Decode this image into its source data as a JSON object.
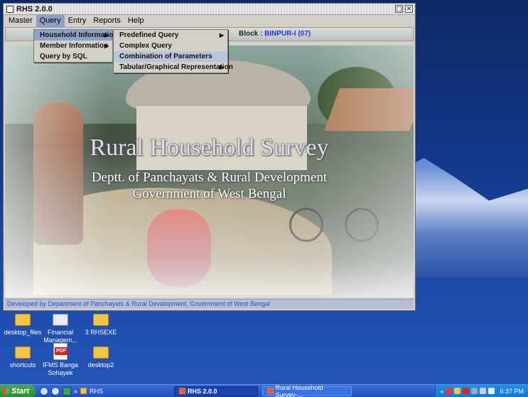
{
  "window": {
    "title": "RHS 2.0.0",
    "menus": [
      "Master",
      "Query",
      "Entry",
      "Reports",
      "Help"
    ],
    "block_label": "Block :",
    "block_value": "BINPUR-I (07)",
    "splash": {
      "title": "Rural Household Survey",
      "line1": "Deptt. of Panchayats & Rural Development",
      "line2": "Government of West Bengal"
    },
    "status": "Developed by Department of Panchayats & Rural Development, Government of West Bengal"
  },
  "query_menu": {
    "items": [
      "Household Information",
      "Member Information",
      "Query by SQL"
    ],
    "selected": "Household Information"
  },
  "household_submenu": {
    "items": [
      "Predefined Query",
      "Complex Query",
      "Combination of Parameters",
      "Tabular/Graphical Representation"
    ],
    "highlighted": "Combination of Parameters"
  },
  "desktop_icons": [
    {
      "label": "desktop_files"
    },
    {
      "label": "Financial Managem..."
    },
    {
      "label": "3 RHSEXE"
    },
    {
      "label": "shortcuts"
    },
    {
      "label": "IFMS Banga Sohayek"
    },
    {
      "label": "desktop2"
    }
  ],
  "taskbar": {
    "start": "Start",
    "quicklaunch_label": "RHS",
    "tasks": [
      "RHS 2.0.0",
      "Rural Household Survey-..."
    ],
    "time": "6:37 PM"
  }
}
